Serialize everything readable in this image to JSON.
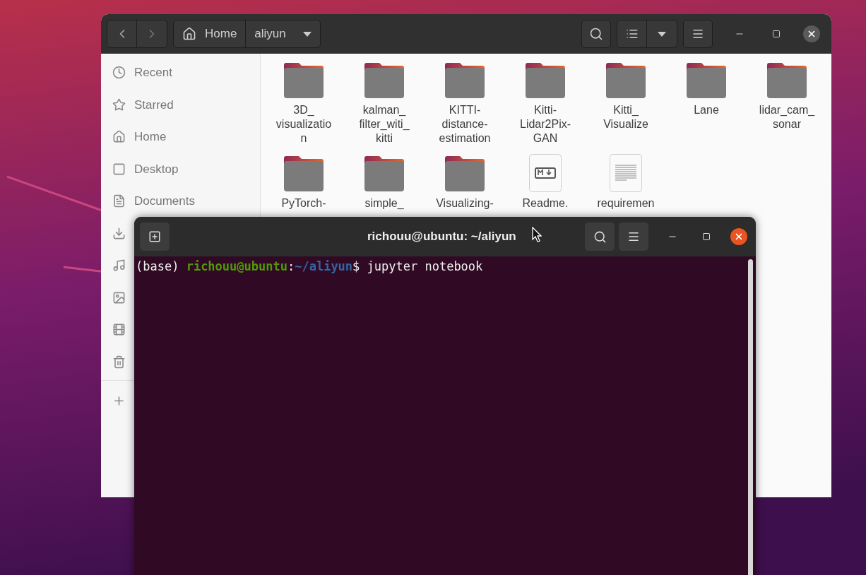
{
  "file_manager": {
    "path": [
      {
        "label": "Home",
        "kind": "home"
      },
      {
        "label": "aliyun",
        "kind": "current"
      }
    ],
    "sidebar": [
      {
        "label": "Recent",
        "kind": "recent"
      },
      {
        "label": "Starred",
        "kind": "starred"
      },
      {
        "label": "Home",
        "kind": "home"
      },
      {
        "label": "Desktop",
        "kind": "desktop"
      },
      {
        "label": "Documents",
        "kind": "documents"
      },
      {
        "kind": "downloads"
      },
      {
        "kind": "music"
      },
      {
        "kind": "pictures"
      },
      {
        "kind": "videos"
      },
      {
        "kind": "trash"
      },
      {
        "kind": "other"
      }
    ],
    "items": [
      {
        "name": "3D_\nvisualizatio\nn",
        "kind": "folder"
      },
      {
        "name": "kalman_\nfilter_witi_\nkitti",
        "kind": "folder"
      },
      {
        "name": "KITTI-\ndistance-\nestimation",
        "kind": "folder"
      },
      {
        "name": "Kitti-\nLidar2Pix-\nGAN",
        "kind": "folder"
      },
      {
        "name": "Kitti_\nVisualize",
        "kind": "folder"
      },
      {
        "name": "Lane",
        "kind": "folder"
      },
      {
        "name": "lidar_cam_\nsonar",
        "kind": "folder"
      },
      {
        "name": "PyTorch-",
        "kind": "folder"
      },
      {
        "name": "simple_",
        "kind": "folder"
      },
      {
        "name": "Visualizing-",
        "kind": "folder"
      },
      {
        "name": "Readme.",
        "kind": "markdown"
      },
      {
        "name": "requiremen",
        "kind": "text"
      }
    ]
  },
  "terminal": {
    "title": "richouu@ubuntu: ~/aliyun",
    "line": [
      {
        "text": "(base) ",
        "kind": "plain"
      },
      {
        "text": "richouu@ubuntu",
        "kind": "user"
      },
      {
        "text": ":",
        "kind": "plain"
      },
      {
        "text": "~/aliyun",
        "kind": "path"
      },
      {
        "text": "$ jupyter notebook",
        "kind": "plain"
      }
    ]
  }
}
